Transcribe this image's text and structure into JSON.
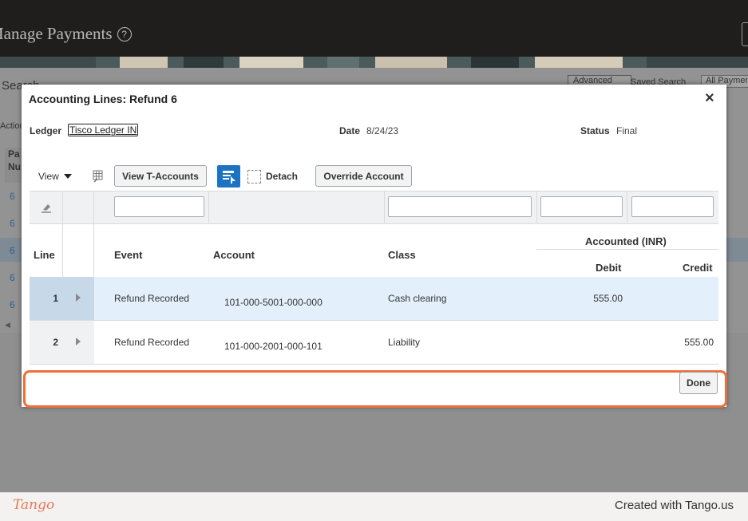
{
  "app": {
    "title": "Manage Payments",
    "help_glyph": "?",
    "background": {
      "search_label": "Search",
      "advanced_label": "Advanced",
      "saved_search_label": "Saved Search",
      "saved_search_value": "All Payments",
      "actions_label": "Actions",
      "column_header": "Pa Nu",
      "row_links": [
        "6",
        "6",
        "6",
        "6",
        "6"
      ]
    }
  },
  "dialog": {
    "title": "Accounting Lines: Refund 6",
    "close_glyph": "×",
    "ledger_label": "Ledger",
    "ledger_value": "Tisco Ledger IN",
    "date_label": "Date",
    "date_value": "8/24/23",
    "status_label": "Status",
    "status_value": "Final",
    "toolbar": {
      "view_label": "View",
      "view_t_accounts_label": "View T-Accounts",
      "detach_label": "Detach",
      "override_account_label": "Override Account"
    },
    "table": {
      "headers": {
        "line": "Line",
        "event": "Event",
        "account": "Account",
        "class": "Class",
        "accounted_group": "Accounted (INR)",
        "debit": "Debit",
        "credit": "Credit"
      },
      "rows": [
        {
          "line": "1",
          "event": "Refund Recorded",
          "account": "101-000-5001-000-000",
          "class": "Cash clearing",
          "debit": "555.00",
          "credit": ""
        },
        {
          "line": "2",
          "event": "Refund Recorded",
          "account": "101-000-2001-000-101",
          "class": "Liability",
          "debit": "",
          "credit": "555.00"
        }
      ]
    },
    "done_label": "Done"
  },
  "footer": {
    "logo_text": "Tango",
    "credit_text": "Created with Tango.us"
  },
  "colors": {
    "accent_blue": "#1c73c4",
    "highlight_orange": "#f06e3c",
    "selected_row": "#e3f0fb",
    "tango_brand": "#e9785a"
  },
  "icons": {
    "help": "help-circle-icon",
    "close": "close-icon",
    "view_menu": "chevron-down-icon",
    "grid": "grid-icon",
    "freeze": "freeze-columns-icon",
    "detach": "detach-icon",
    "clear_filter": "eraser-icon",
    "row_expand": "triangle-right-icon"
  }
}
